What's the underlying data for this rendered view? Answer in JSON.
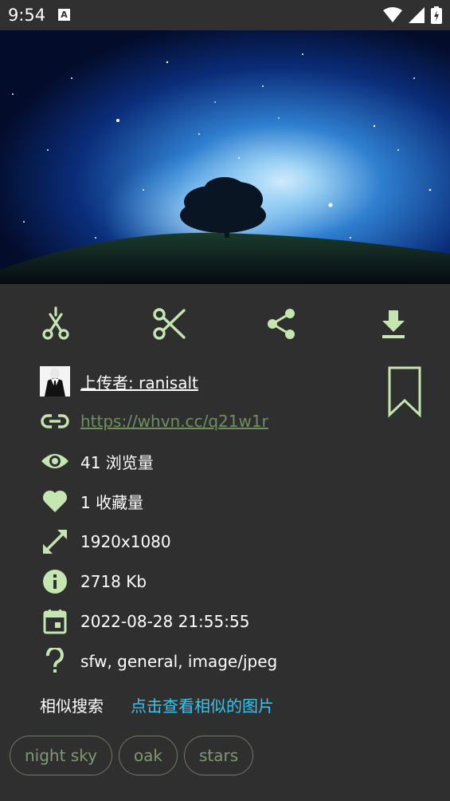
{
  "status_bar": {
    "time": "9:54",
    "notification_letter": "A"
  },
  "actions": [
    {
      "name": "crop-alt",
      "icon": "scissors-rotated-icon"
    },
    {
      "name": "cut",
      "icon": "scissors-icon"
    },
    {
      "name": "share",
      "icon": "share-icon"
    },
    {
      "name": "download",
      "icon": "download-icon"
    }
  ],
  "details": {
    "uploader": "上传者: ranisalt",
    "url": "https://whvn.cc/q21w1r",
    "views": "41 浏览量",
    "favorites": "1 收藏量",
    "resolution": "1920x1080",
    "size": "2718 Kb",
    "date": "2022-08-28 21:55:55",
    "category": "sfw, general, image/jpeg"
  },
  "similar": {
    "label": "相似搜索",
    "link": "点击查看相似的图片"
  },
  "tags": [
    "night sky",
    "oak",
    "stars"
  ],
  "colors": {
    "accent": "#c5e6b0",
    "link": "#36c5f0",
    "background": "#2f2f2f"
  }
}
